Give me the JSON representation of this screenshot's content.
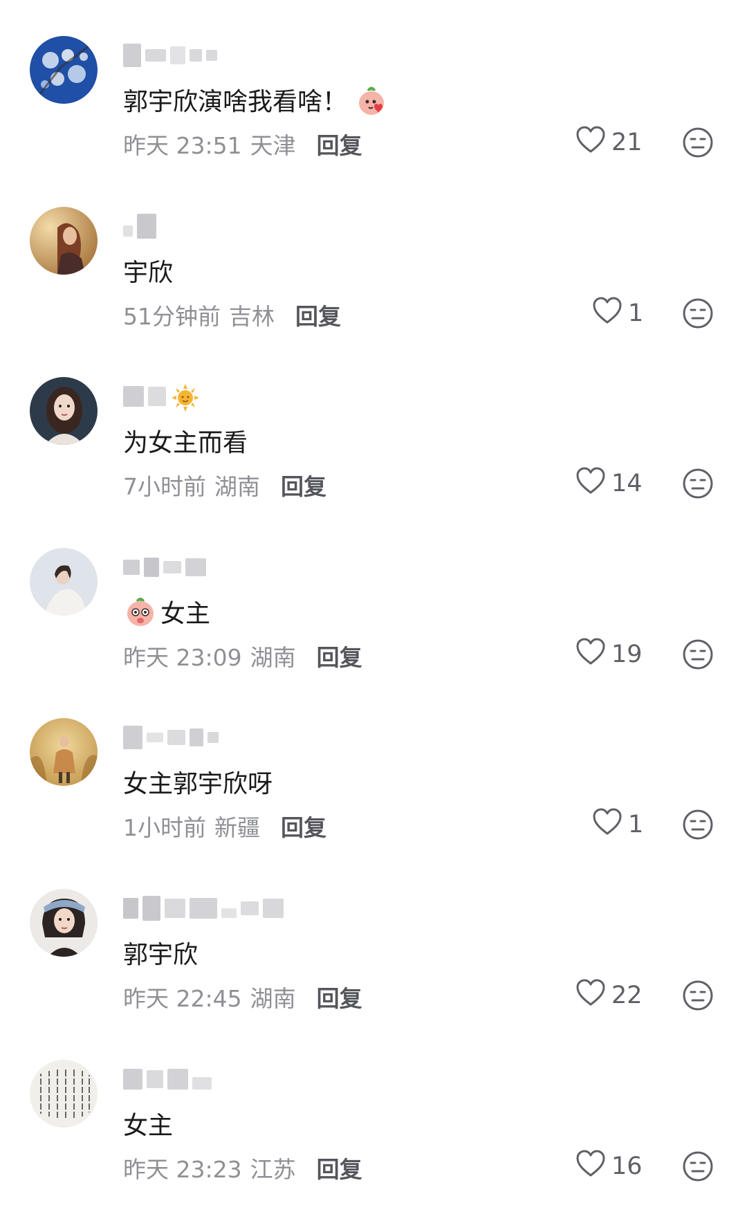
{
  "comments": [
    {
      "content": "郭宇欣演啥我看啥！",
      "time": "昨天 23:51",
      "location": "天津",
      "reply_label": "回复",
      "likes": "21",
      "emoji_after": "peach-blush-emoji",
      "emoji_before": ""
    },
    {
      "content": "宇欣",
      "time": "51分钟前",
      "location": "吉林",
      "reply_label": "回复",
      "likes": "1",
      "emoji_after": "",
      "emoji_before": ""
    },
    {
      "content": "为女主而看",
      "time": "7小时前",
      "location": "湖南",
      "reply_label": "回复",
      "likes": "14",
      "emoji_after": "",
      "emoji_before": ""
    },
    {
      "content": "女主",
      "time": "昨天 23:09",
      "location": "湖南",
      "reply_label": "回复",
      "likes": "19",
      "emoji_after": "",
      "emoji_before": "peach-shy-emoji"
    },
    {
      "content": "女主郭宇欣呀",
      "time": "1小时前",
      "location": "新疆",
      "reply_label": "回复",
      "likes": "1",
      "emoji_after": "",
      "emoji_before": ""
    },
    {
      "content": "郭宇欣",
      "time": "昨天 22:45",
      "location": "湖南",
      "reply_label": "回复",
      "likes": "22",
      "emoji_after": "",
      "emoji_before": ""
    },
    {
      "content": "女主",
      "time": "昨天 23:23",
      "location": "江苏",
      "reply_label": "回复",
      "likes": "16",
      "emoji_after": "",
      "emoji_before": ""
    }
  ],
  "icons": {
    "like": "heart-outline-icon",
    "dislike": "neutral-face-icon",
    "sun_badge": "sun-badge-icon"
  },
  "colors": {
    "text_primary": "#1a1a1a",
    "text_secondary": "#8f9095",
    "icon": "#5f6066",
    "peach": "#f6b3a8",
    "badge_yellow": "#f5b533"
  }
}
